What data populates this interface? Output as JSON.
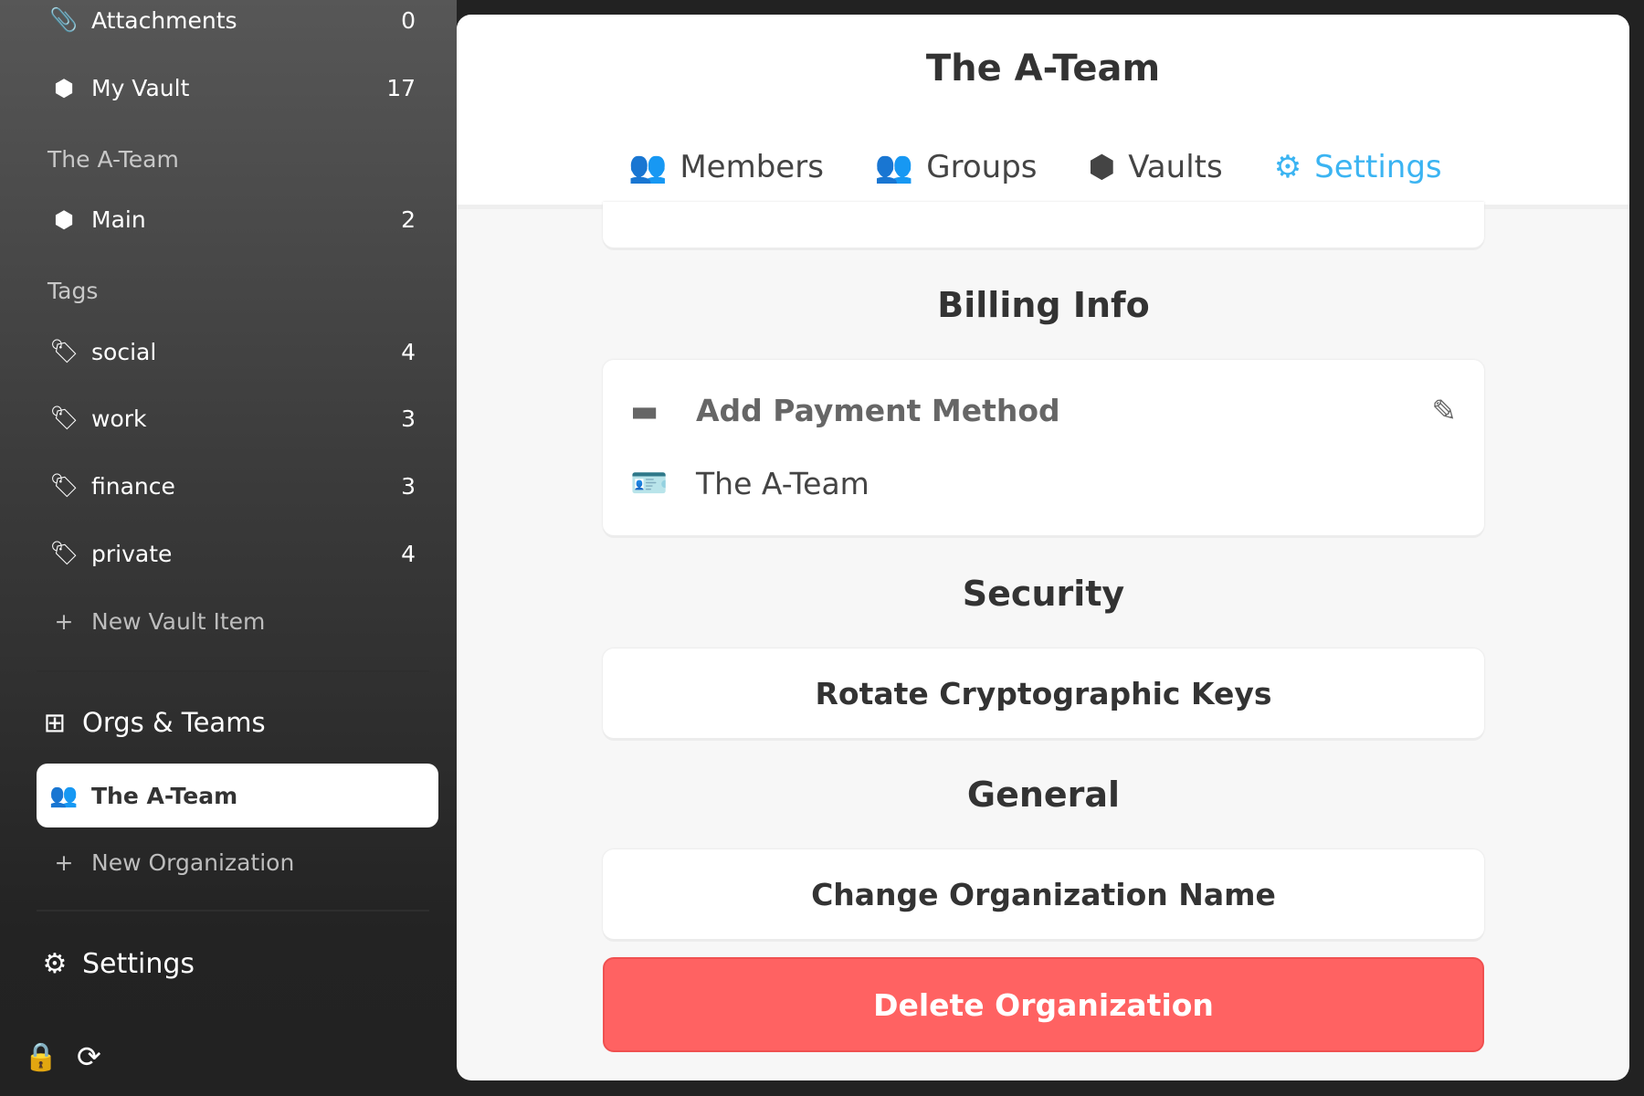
{
  "sidebar": {
    "items": [
      {
        "label": "Attachments",
        "count": "0"
      },
      {
        "label": "My Vault",
        "count": "17"
      }
    ],
    "org_section": "The A-Team",
    "org_items": [
      {
        "label": "Main",
        "count": "2"
      }
    ],
    "tags_section": "Tags",
    "tags": [
      {
        "label": "social",
        "count": "4"
      },
      {
        "label": "work",
        "count": "3"
      },
      {
        "label": "finance",
        "count": "3"
      },
      {
        "label": "private",
        "count": "4"
      }
    ],
    "new_item": "New Vault Item",
    "orgs_header": "Orgs & Teams",
    "selected_org": "The A-Team",
    "new_org": "New Organization",
    "settings": "Settings"
  },
  "main": {
    "title": "The A-Team",
    "tabs": [
      {
        "label": "Members"
      },
      {
        "label": "Groups"
      },
      {
        "label": "Vaults"
      },
      {
        "label": "Settings"
      }
    ],
    "billing_heading": "Billing Info",
    "payment": "Add Payment Method",
    "billing_name": "The A-Team",
    "security_heading": "Security",
    "rotate": "Rotate Cryptographic Keys",
    "general_heading": "General",
    "rename": "Change Organization Name",
    "delete": "Delete Organization"
  },
  "colors": {
    "accent": "#3bb4f2",
    "danger": "#ff6262"
  }
}
